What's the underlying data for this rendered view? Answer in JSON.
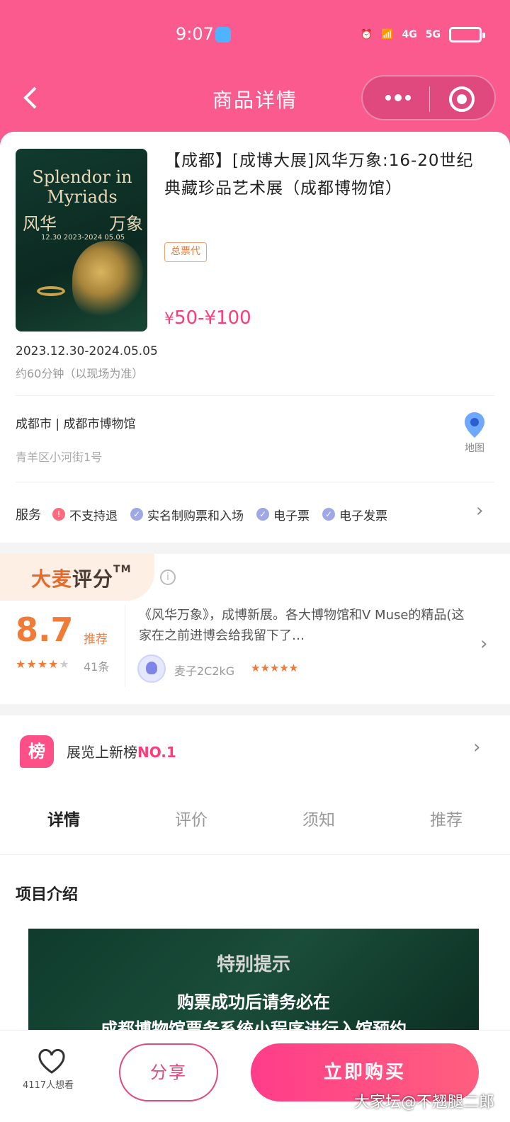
{
  "status_bar": {
    "time": "9:07",
    "net1": "4G",
    "net2": "5G"
  },
  "nav": {
    "title": "商品详情",
    "back": "<",
    "more": "•••"
  },
  "product": {
    "poster": {
      "en": "Splendor in Myriads",
      "cn_left": "风华",
      "cn_right": "万象",
      "dates": "12.30  2023-2024  05.05"
    },
    "title": "【成都】[成博大展]风华万象:16-20世纪典藏珍品艺术展（成都博物馆）",
    "tag": "总票代",
    "price_prefix": "¥",
    "price_range": "50-¥100",
    "date": "2023.12.30-2024.05.05",
    "duration": "约60分钟（以现场为准）",
    "venue": "成都市 | 成都市博物馆",
    "address": "青羊区小河街1号",
    "map_label": "地图",
    "services_label": "服务",
    "services": [
      {
        "label": "不支持退",
        "icon": "warning-icon"
      },
      {
        "label": "实名制购票和入场",
        "icon": "check-icon"
      },
      {
        "label": "电子票",
        "icon": "check-icon"
      },
      {
        "label": "电子发票",
        "icon": "check-icon"
      }
    ]
  },
  "rating": {
    "brand_a": "大麦",
    "brand_b": "评分",
    "tm": "TM",
    "score": "8.7",
    "recommend": "推荐",
    "stars_on": "★★★★",
    "stars_off": "★",
    "count": "41条",
    "review": "《风华万象》，成博新展。各大博物馆和V Muse的精品(这家在之前进博会给我留下了…",
    "user": "麦子2C2kG",
    "user_stars": "★★★★★"
  },
  "rank": {
    "icon": "榜",
    "text": "展览上新榜",
    "no": "NO.1"
  },
  "tabs": [
    "详情",
    "评价",
    "须知",
    "推荐"
  ],
  "intro": {
    "title": "项目介绍",
    "image_line1": "特别提示",
    "image_line2": "购票成功后请务必在",
    "image_line3": "成都博物馆票务系统小程序进行入馆预约"
  },
  "bottom": {
    "fav_count": "4117人想看",
    "share": "分享",
    "buy": "立即购买"
  },
  "watermark": "大家坛@不翘腿二郎",
  "colors": {
    "brand": "#fa5a8e",
    "price": "#ff3c7a",
    "rating": "#f07b36"
  }
}
